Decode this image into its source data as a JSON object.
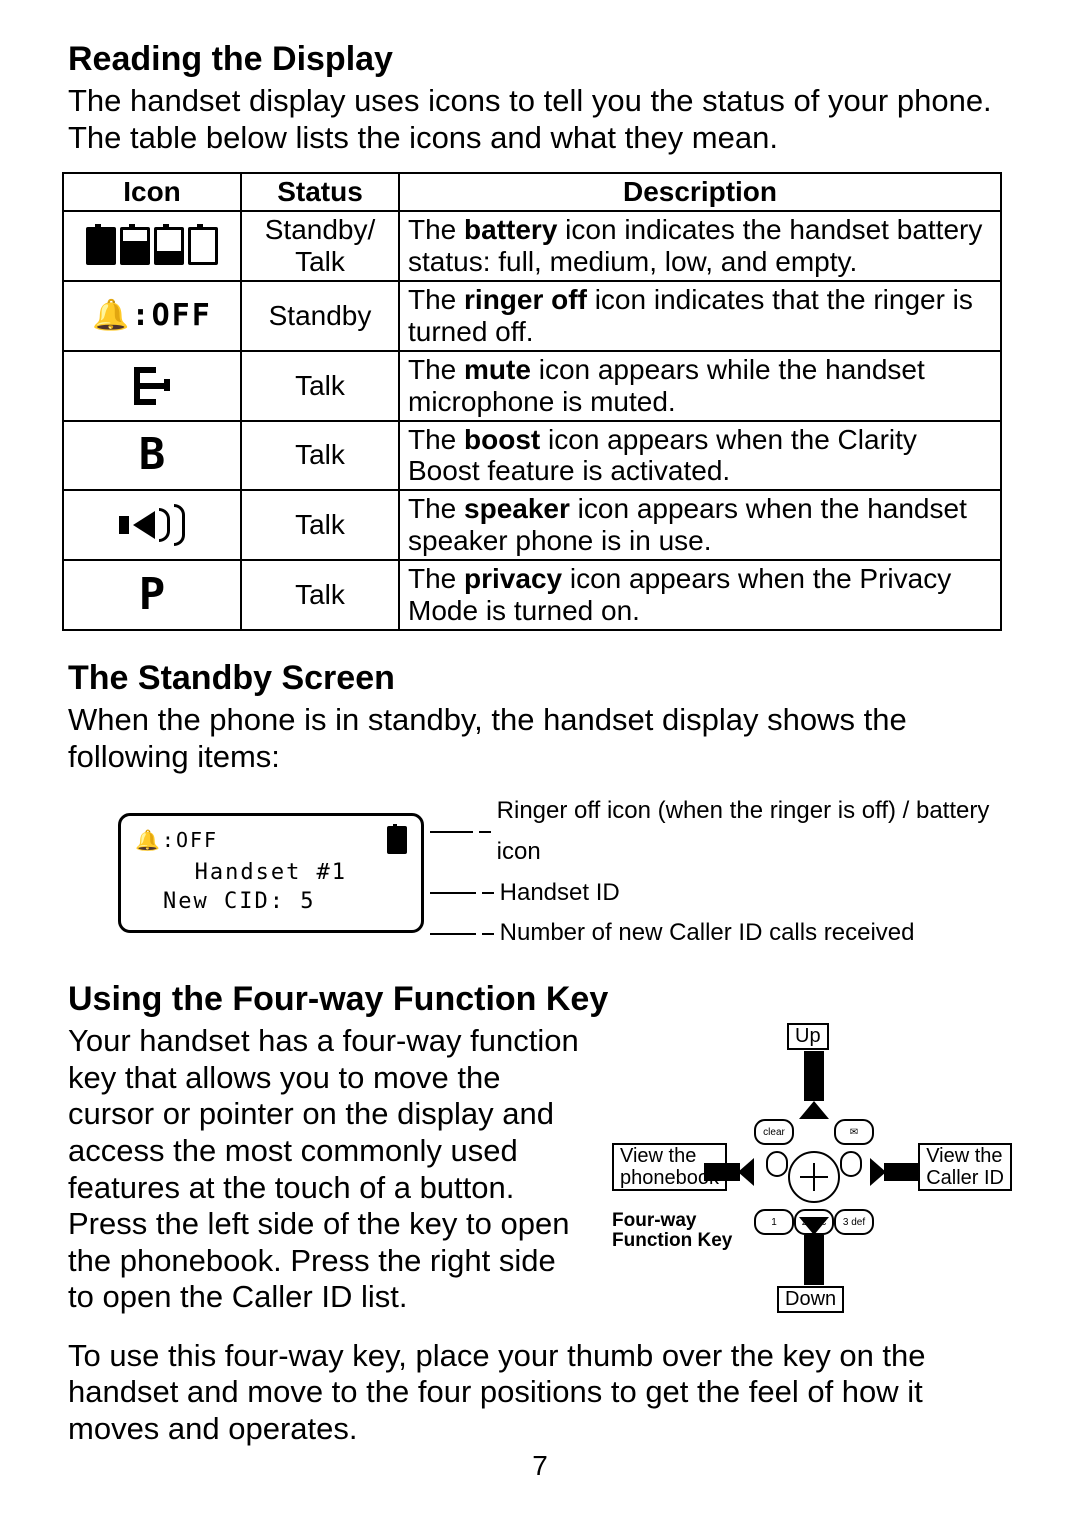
{
  "sections": {
    "reading": {
      "heading": "Reading the Display",
      "intro": "The handset display uses icons to tell you the status of your phone. The table below lists the icons and what they mean."
    },
    "standby": {
      "heading": "The Standby Screen",
      "intro": "When the phone is in standby, the handset display shows the following items:"
    },
    "fourway": {
      "heading": "Using the Four-way Function Key",
      "para1": "Your handset has a four-way function key that allows you to move the cursor or pointer on the display and access the most commonly used features at the touch of a button. Press the left side of the key to open the phonebook. Press the right side to open the Caller ID list.",
      "para2": "To use this four-way key, place your thumb over the key on the handset and move to the four positions to get the feel of how it moves and operates."
    }
  },
  "icon_table": {
    "headers": {
      "icon": "Icon",
      "status": "Status",
      "description": "Description"
    },
    "rows": [
      {
        "icon_name": "battery-levels-icon",
        "status": "Standby/ Talk",
        "desc_bold": "battery",
        "desc_pre": "The ",
        "desc_post": " icon indicates the handset battery status: full, medium, low, and empty."
      },
      {
        "icon_name": "ringer-off-icon",
        "icon_text": "🔔:OFF",
        "status": "Standby",
        "desc_bold": "ringer off",
        "desc_pre": "The ",
        "desc_post": " icon indicates that the ringer is turned off."
      },
      {
        "icon_name": "mute-icon",
        "status": "Talk",
        "desc_bold": "mute",
        "desc_pre": "The ",
        "desc_post": " icon appears while the handset microphone is muted."
      },
      {
        "icon_name": "boost-icon",
        "icon_text": "B",
        "status": "Talk",
        "desc_bold": "boost",
        "desc_pre": "The ",
        "desc_post": " icon appears when the Clarity Boost feature is activated."
      },
      {
        "icon_name": "speaker-icon",
        "status": "Talk",
        "desc_bold": "speaker",
        "desc_pre": "The ",
        "desc_post": " icon appears when the handset speaker phone is in use."
      },
      {
        "icon_name": "privacy-icon",
        "icon_text": "P",
        "status": "Talk",
        "desc_bold": "privacy",
        "desc_pre": "The ",
        "desc_post": " icon appears when the Privacy Mode is turned on."
      }
    ]
  },
  "standby_screen": {
    "lcd": {
      "line1_left": "🔔:OFF",
      "line2": "Handset #1",
      "line3": "New CID: 5"
    },
    "callouts": {
      "row1": "Ringer off icon (when the ringer is off) / battery icon",
      "row2": "Handset ID",
      "row3": "Number of new Caller ID calls received"
    }
  },
  "fourway_diagram": {
    "up": "Up",
    "down": "Down",
    "left": "View the\nphonebook",
    "right": "View the\nCaller ID",
    "caption": "Four-way\nFunction Key",
    "keypad": {
      "r1": [
        "clear",
        "",
        "✉"
      ],
      "r3": [
        "1",
        "2 abc",
        "3 def"
      ]
    }
  },
  "page_number": "7"
}
